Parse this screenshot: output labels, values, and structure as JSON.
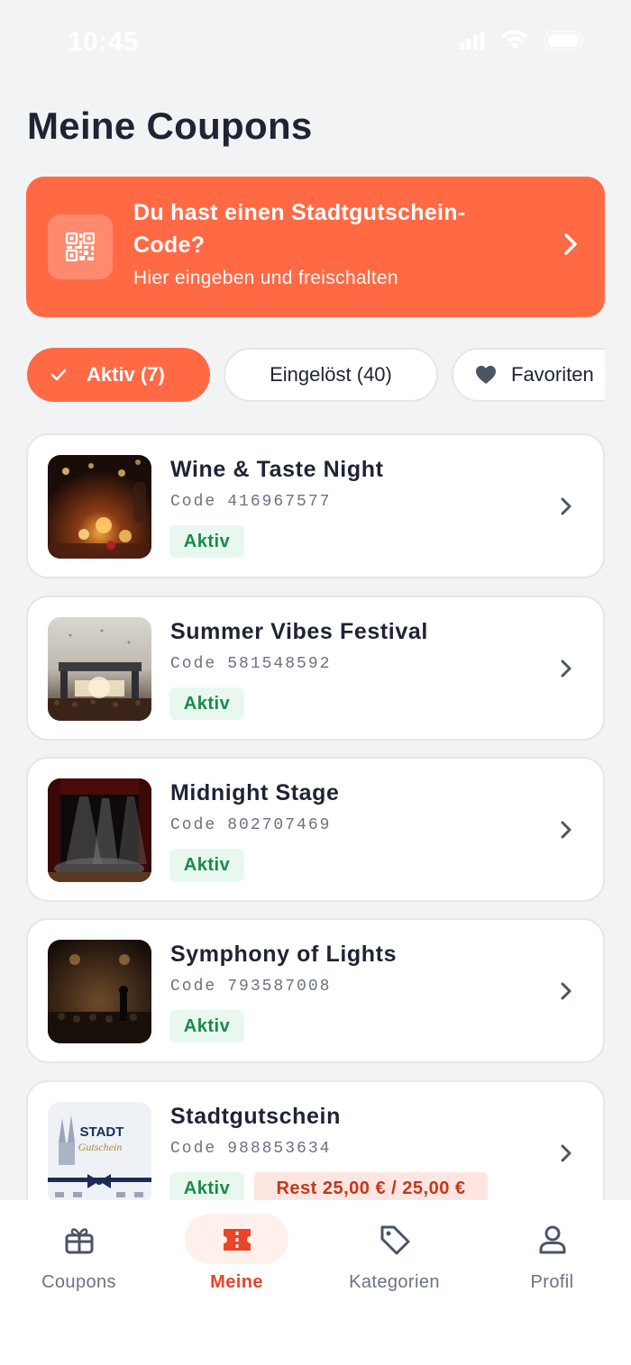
{
  "status_bar": {
    "time": "10:45"
  },
  "page": {
    "title": "Meine Coupons"
  },
  "promo": {
    "title": "Du hast einen Stadtgutschein-Code?",
    "subtitle": "Hier eingeben und freischalten",
    "icon": "qr-code-icon",
    "color": "#ff6a45"
  },
  "filters": {
    "active": "Aktiv (7)",
    "redeemed": "Eingelöst (40)",
    "favorites": "Favoriten"
  },
  "coupons": [
    {
      "title": "Wine & Taste Night",
      "code_label": "Code",
      "code": "416967577",
      "status": "Aktiv"
    },
    {
      "title": "Summer Vibes Festival",
      "code_label": "Code",
      "code": "581548592",
      "status": "Aktiv"
    },
    {
      "title": "Midnight Stage",
      "code_label": "Code",
      "code": "802707469",
      "status": "Aktiv"
    },
    {
      "title": "Symphony of Lights",
      "code_label": "Code",
      "code": "793587008",
      "status": "Aktiv"
    },
    {
      "title": "Stadtgutschein",
      "code_label": "Code",
      "code": "988853634",
      "status": "Aktiv",
      "rest": "Rest 25,00 € / 25,00 €",
      "thumb_text": "STADT",
      "thumb_script": "Gutschein"
    }
  ],
  "tabbar": {
    "items": [
      {
        "label": "Coupons",
        "icon": "gift-icon"
      },
      {
        "label": "Meine",
        "icon": "ticket-icon",
        "active": true
      },
      {
        "label": "Kategorien",
        "icon": "tag-icon"
      },
      {
        "label": "Profil",
        "icon": "user-icon"
      }
    ]
  },
  "colors": {
    "accent": "#ff6a45",
    "active_tab": "#e8452a",
    "status_green": "#1a8a4a",
    "rest_red": "#c9351a"
  }
}
